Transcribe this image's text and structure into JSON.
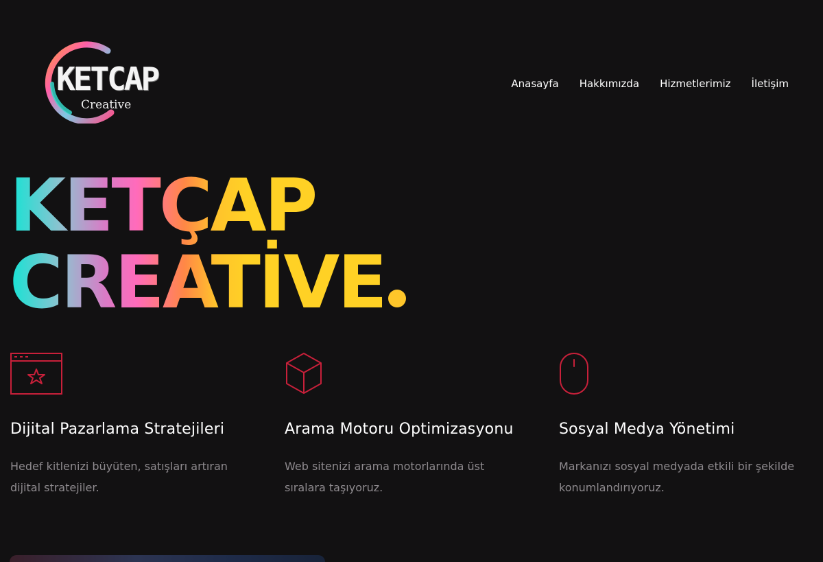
{
  "header": {
    "logo": {
      "wordmark": "KETCAP",
      "subtitle": "Creative"
    },
    "nav": [
      {
        "label": "Anasayfa"
      },
      {
        "label": "Hakkımızda"
      },
      {
        "label": "Hizmetlerimiz"
      },
      {
        "label": "İletişim"
      }
    ]
  },
  "hero": {
    "line1": "KETÇAP",
    "line2": "CREATİVE",
    "gradient_colors": [
      "#14e3d4",
      "#ff6bbb",
      "#ff8746",
      "#ffc32c"
    ],
    "dot_color": "#ffc62a"
  },
  "services": [
    {
      "icon": "browser-star-icon",
      "title": "Dijital Pazarlama Stratejileri",
      "description": "Hedef kitlenizi büyüten, satışları artıran dijital stratejiler."
    },
    {
      "icon": "cube-icon",
      "title": "Arama Motoru Optimizasyonu",
      "description": "Web sitenizi arama motorlarında üst sıralara taşıyoruz."
    },
    {
      "icon": "mouse-icon",
      "title": "Sosyal Medya Yönetimi",
      "description": "Markanızı sosyal medyada etkili bir şekilde konumlandırıyoruz."
    }
  ],
  "colors": {
    "background": "#121112",
    "icon_accent": "#c8203a",
    "body_text": "#8e8a8e"
  }
}
